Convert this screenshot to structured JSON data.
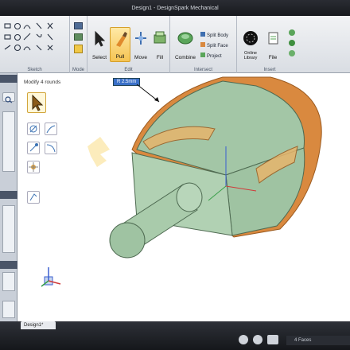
{
  "window": {
    "title": "Design1 - DesignSpark Mechanical"
  },
  "ribbon": {
    "groups": {
      "sketch": "Sketch",
      "mode": "Mode",
      "edit": "Edit",
      "intersect": "Intersect",
      "insert": "Insert"
    },
    "tools": {
      "select": "Select",
      "pull": "Pull",
      "move": "Move",
      "fill": "Fill",
      "combine": "Combine",
      "split_body": "Split Body",
      "split_face": "Split Face",
      "project": "Project",
      "online_library": "Online Library",
      "file": "File"
    }
  },
  "canvas": {
    "status_hint": "Modify 4 rounds",
    "dimension_tag": "R  2.5mm"
  },
  "statusbar": {
    "document_tab": "Design1*",
    "selection_count": "4 Faces"
  },
  "colors": {
    "model_body": "#a3c6a6",
    "round_faces": "#d9893f",
    "highlight": "#f5d46b",
    "accent": "#f5c453"
  }
}
